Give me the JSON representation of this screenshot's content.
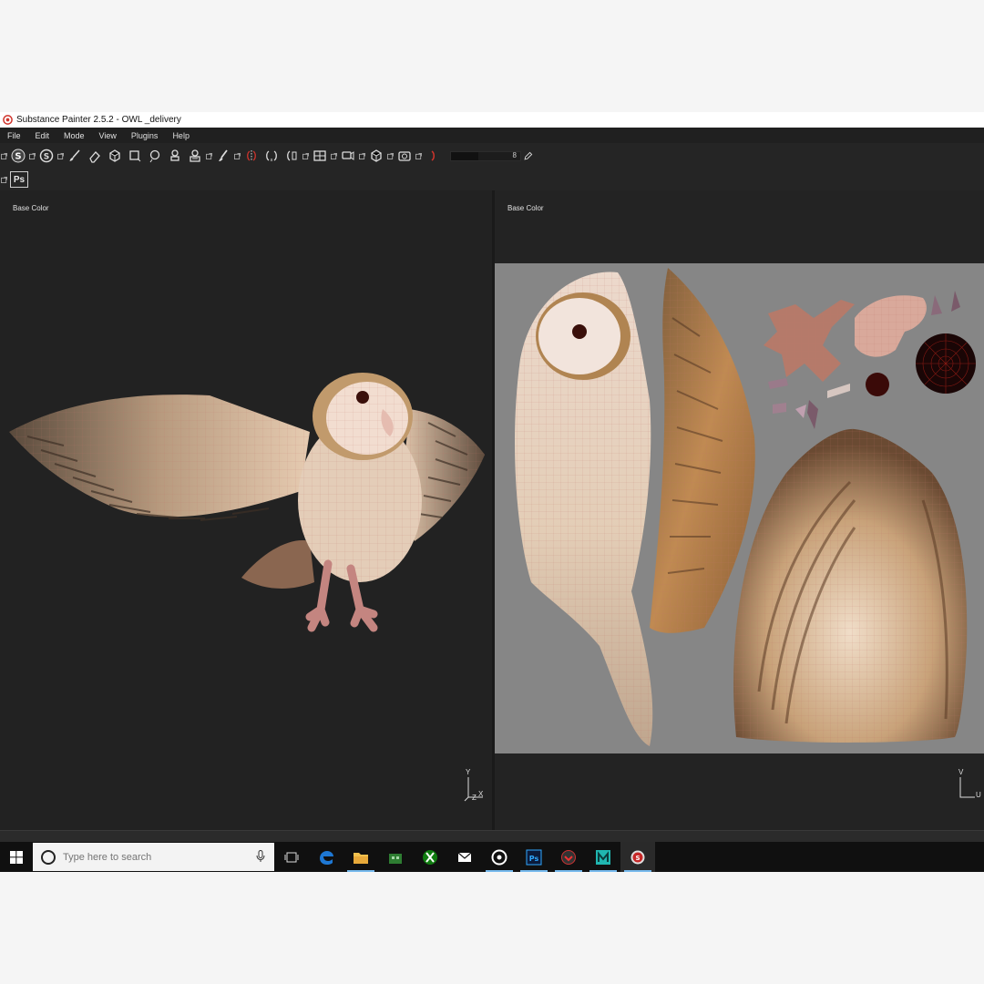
{
  "window": {
    "title": "Substance Painter 2.5.2 - OWL _delivery"
  },
  "menu": [
    "File",
    "Edit",
    "Mode",
    "View",
    "Plugins",
    "Help"
  ],
  "toolbar": {
    "slider_value": "8",
    "ps_label": "Ps"
  },
  "viewports": {
    "left": {
      "label": "Base Color",
      "axes": {
        "up": "Y",
        "side": "X",
        "depth": "Z"
      }
    },
    "right": {
      "label": "Base Color",
      "axes": {
        "up": "V",
        "side": "U"
      }
    }
  },
  "taskbar": {
    "search_placeholder": "Type here to search",
    "apps": [
      "task-view",
      "edge",
      "file-explorer",
      "store",
      "xbox",
      "mail",
      "groove",
      "photoshop",
      "app-red",
      "maya",
      "substance-painter"
    ]
  },
  "colors": {
    "accent": "#76b9ed",
    "uv_background": "#868686",
    "viewport_background": "#222222"
  }
}
